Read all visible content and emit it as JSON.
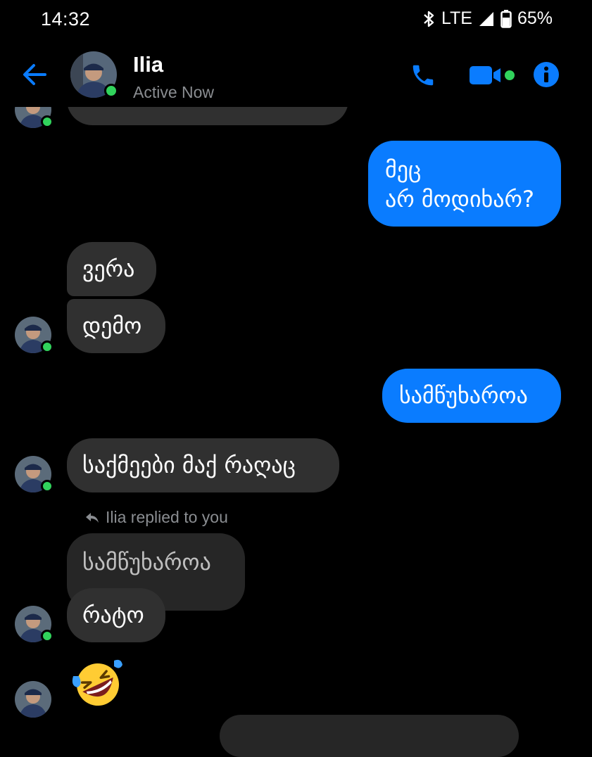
{
  "status_bar": {
    "time": "14:32",
    "network": "LTE",
    "battery": "65%"
  },
  "header": {
    "name": "Ilia",
    "status": "Active Now",
    "accent": "#0a7cff",
    "online_color": "#31d35c"
  },
  "messages": {
    "out1_line1": "მეც",
    "out1_line2": "არ მოდიხარ?",
    "in1": "ვერა",
    "in2": "დემო",
    "out2": "სამწუხაროა",
    "in3": "საქმეები მაქ რაღაც",
    "reply_note": "Ilia replied to you",
    "quoted": "სამწუხაროა",
    "in4": "რატო"
  },
  "icons": {
    "back": "arrow-left-icon",
    "call": "phone-icon",
    "video": "video-camera-icon",
    "info": "info-icon",
    "emoji": "rolling-on-floor-laughing-emoji"
  }
}
